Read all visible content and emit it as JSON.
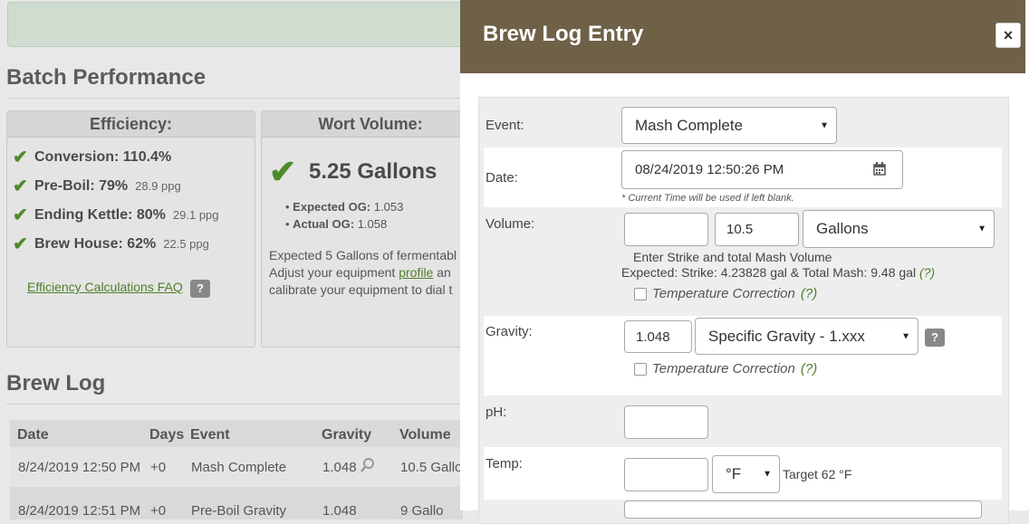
{
  "background": {
    "batch_performance_title": "Batch Performance",
    "efficiency": {
      "header": "Efficiency:",
      "rows": [
        {
          "label": "Conversion: 110.4%",
          "ppg": ""
        },
        {
          "label": "Pre-Boil: 79%",
          "ppg": "28.9 ppg"
        },
        {
          "label": "Ending Kettle: 80%",
          "ppg": "29.1 ppg"
        },
        {
          "label": "Brew House: 62%",
          "ppg": "22.5 ppg"
        }
      ],
      "faq_link": "Efficiency Calculations FAQ",
      "faq_badge": "?"
    },
    "wort_volume": {
      "header": "Wort Volume:",
      "value": "5.25 Gallons",
      "expected_og_label": "Expected OG:",
      "expected_og_value": "1.053",
      "actual_og_label": "Actual OG:",
      "actual_og_value": "1.058",
      "text_line1": "Expected 5 Gallons of fermentabl",
      "text_line2_pre": "Adjust your equipment ",
      "text_line2_link": "profile",
      "text_line2_post": " an",
      "text_line3": "calibrate your equipment to dial t"
    },
    "brew_log_title": "Brew Log",
    "table": {
      "headers": [
        "Date",
        "Days",
        "Event",
        "Gravity",
        "Volume"
      ],
      "rows": [
        {
          "date": "8/24/2019 12:50 PM",
          "days": "+0",
          "event": "Mash Complete",
          "gravity": "1.048",
          "volume": "10.5 Gallo"
        },
        {
          "date": "8/24/2019 12:51 PM",
          "days": "+0",
          "event": "Pre-Boil Gravity",
          "gravity": "1.048",
          "volume": "9 Gallo"
        }
      ]
    }
  },
  "modal": {
    "title": "Brew Log Entry",
    "close_glyph": "×",
    "event_label": "Event:",
    "event_value": "Mash Complete",
    "date_label": "Date:",
    "date_value": "08/24/2019 12:50:26 PM",
    "date_note": "* Current Time will be used if left blank.",
    "volume_label": "Volume:",
    "volume_strike_value": "",
    "volume_total_value": "10.5",
    "volume_unit": "Gallons",
    "volume_hint": "Enter Strike and total Mash Volume",
    "volume_expected": "Expected: Strike: 4.23828 gal & Total Mash: 9.48 gal",
    "help_link": "(?)",
    "temp_correction": "Temperature Correction",
    "gravity_label": "Gravity:",
    "gravity_value": "1.048",
    "gravity_unit": "Specific Gravity - 1.xxx",
    "gravity_badge": "?",
    "ph_label": "pH:",
    "ph_value": "",
    "temp_label": "Temp:",
    "temp_value": "",
    "temp_unit": "°F",
    "temp_target": "Target 62 °F"
  },
  "colors": {
    "modal_header": "#6e6148",
    "accent_green": "#4f7f2a"
  }
}
